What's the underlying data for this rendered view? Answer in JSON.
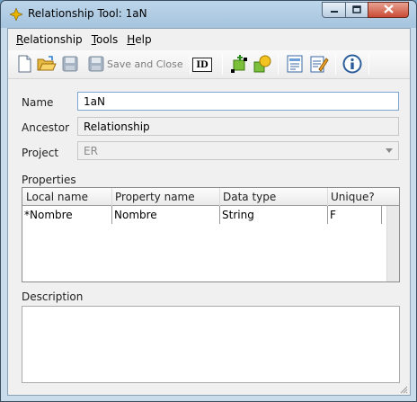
{
  "window": {
    "title": "Relationship Tool: 1aN",
    "controls": {
      "minimize_icon": "minimize-icon",
      "maximize_icon": "maximize-icon",
      "close_icon": "close-icon"
    }
  },
  "menubar": {
    "items": [
      {
        "label": "Relationship",
        "mnemonic": "R",
        "rest": "elationship"
      },
      {
        "label": "Tools",
        "mnemonic": "T",
        "rest": "ools"
      },
      {
        "label": "Help",
        "mnemonic": "H",
        "rest": "elp"
      }
    ]
  },
  "toolbar": {
    "buttons": [
      {
        "icon": "new-document-icon"
      },
      {
        "icon": "open-folder-icon"
      },
      {
        "icon": "save-icon",
        "enabled": false
      },
      {
        "icon": "save-close-icon",
        "enabled": false
      },
      {
        "icon": "id-icon"
      },
      {
        "icon": "add-entity-icon"
      },
      {
        "icon": "shapes-icon"
      },
      {
        "icon": "list-icon"
      },
      {
        "icon": "edit-icon"
      },
      {
        "icon": "info-icon"
      }
    ],
    "save_close_label": "Save and Close",
    "id_label": "ID"
  },
  "form": {
    "name_label": "Name",
    "name_value": "1aN",
    "ancestor_label": "Ancestor",
    "ancestor_value": "Relationship",
    "project_label": "Project",
    "project_value": "ER",
    "properties_label": "Properties",
    "description_label": "Description",
    "description_value": ""
  },
  "properties_table": {
    "columns": [
      "Local name",
      "Property name",
      "Data type",
      "Unique?"
    ],
    "rows": [
      {
        "local_name": "*Nombre",
        "property_name": "Nombre",
        "data_type": "String",
        "unique": "F"
      }
    ]
  },
  "colors": {
    "frame": "#c9dcec",
    "client_bg": "#f0f0f0",
    "focus_border": "#7aa6d1",
    "close_button": "#c94a34"
  }
}
